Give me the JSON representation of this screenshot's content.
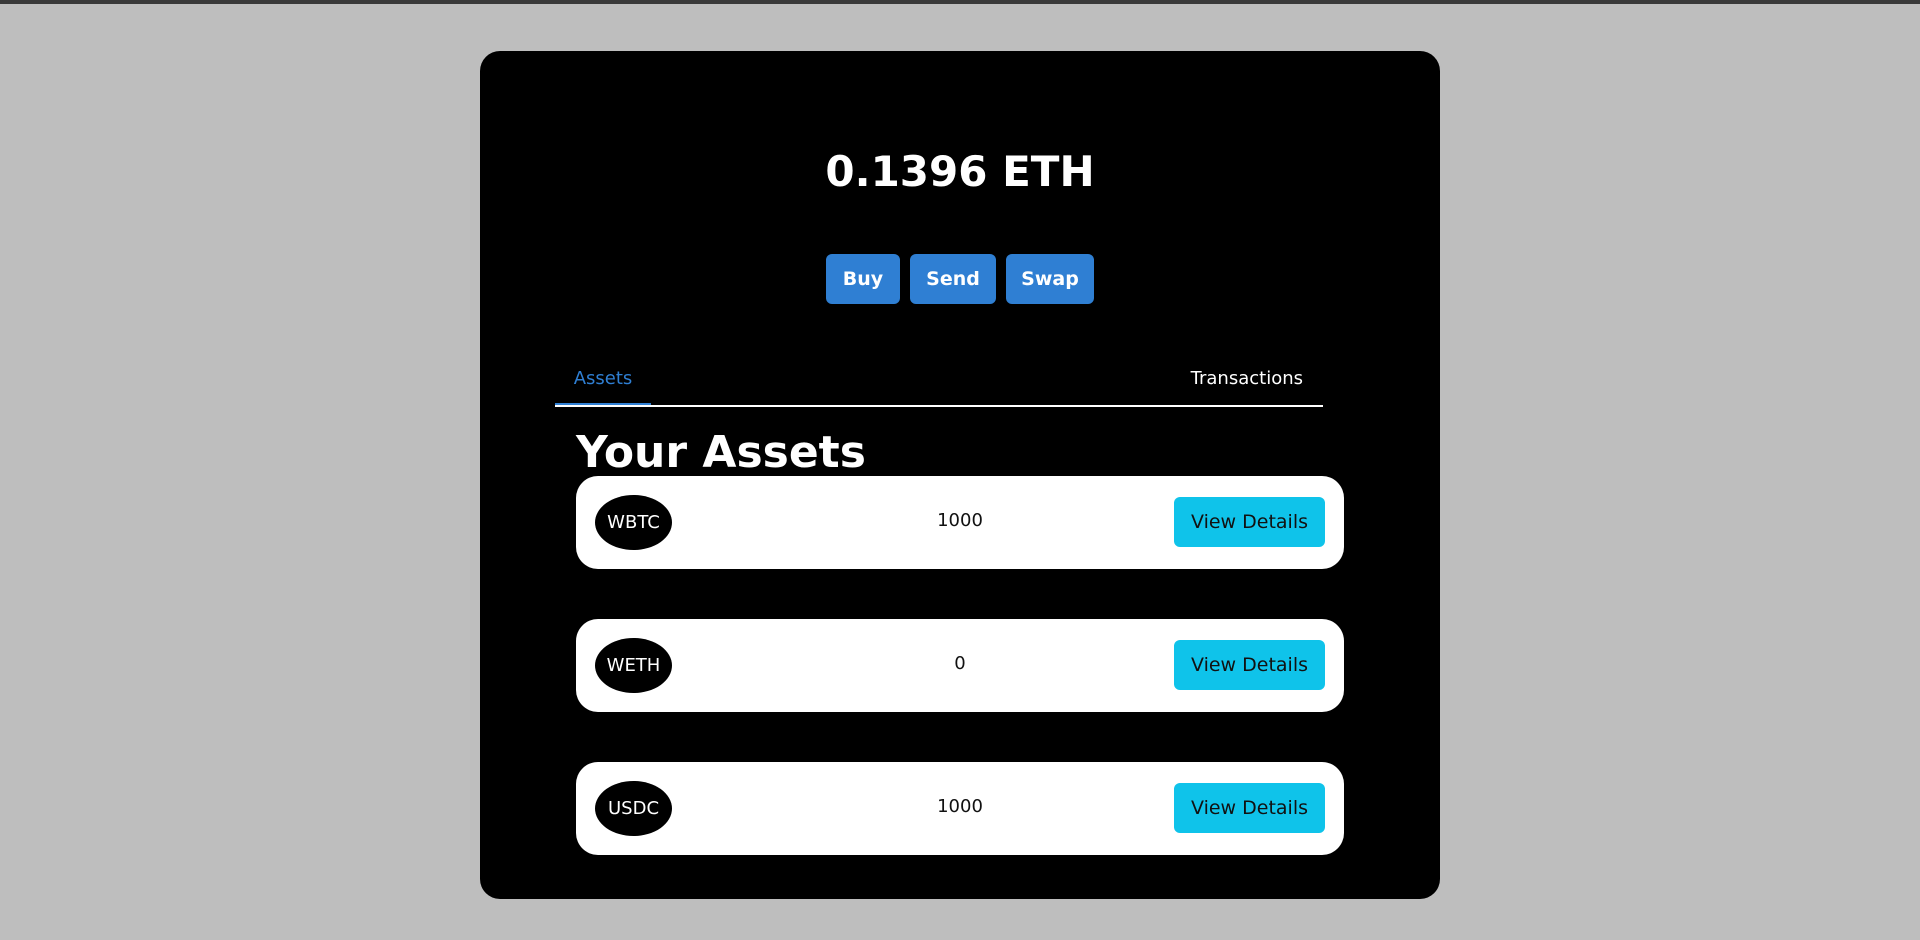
{
  "wallet": {
    "balance": "0.1396 ETH"
  },
  "actions": {
    "buy_label": "Buy",
    "send_label": "Send",
    "swap_label": "Swap"
  },
  "tabs": [
    {
      "label": "Assets",
      "active": true
    },
    {
      "label": "Transactions",
      "active": false
    }
  ],
  "assets_section": {
    "title": "Your Assets",
    "items": [
      {
        "symbol": "WBTC",
        "amount": "1000",
        "button_label": "View Details"
      },
      {
        "symbol": "WETH",
        "amount": "0",
        "button_label": "View Details"
      },
      {
        "symbol": "USDC",
        "amount": "1000",
        "button_label": "View Details"
      }
    ]
  },
  "colors": {
    "page_background": "#bebebe",
    "card_background": "#000000",
    "primary_button": "#2f7fd3",
    "details_button": "#0fc3ea",
    "active_tab": "#2f7fd3"
  }
}
